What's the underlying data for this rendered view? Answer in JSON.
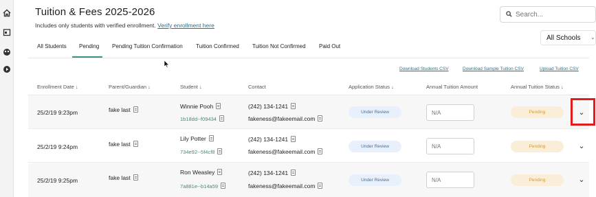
{
  "page": {
    "title": "Tuition & Fees 2025-2026",
    "subtitle": "Includes only students with verified enrollment.",
    "subtitle_link": "Verify enrollment here"
  },
  "search": {
    "placeholder": "Search..."
  },
  "school_filter": {
    "selected": "All Schools"
  },
  "tabs": [
    {
      "label": "All Students",
      "active": false
    },
    {
      "label": "Pending",
      "active": true
    },
    {
      "label": "Pending Tuition Confirmation",
      "active": false
    },
    {
      "label": "Tuition Confirmed",
      "active": false
    },
    {
      "label": "Tuition Not Confirmed",
      "active": false
    },
    {
      "label": "Paid Out",
      "active": false
    }
  ],
  "csv_links": {
    "download_students": "Download Students CSV",
    "download_sample": "Download Sample Tuition CSV",
    "upload": "Upload Tuition CSV"
  },
  "columns": {
    "enrollment_date": "Enrollment Date ↓",
    "parent": "Parent/Guardian ↓",
    "student": "Student ↓",
    "contact": "Contact",
    "application_status": "Application Status ↓",
    "annual_tuition_amount": "Annual Tuition Amount",
    "annual_tuition_status": "Annual Tuition Status ↓"
  },
  "rows": [
    {
      "date": "25/2/19 9:23pm",
      "parent": "fake last",
      "student": "Winnie Pooh",
      "student_id": "1b18dd--f09434",
      "phone": "(242) 134-1241",
      "email": "fakeness@fakeemail.com",
      "app_status": "Under Review",
      "tuition_placeholder": "N/A",
      "tuition_status": "Pending"
    },
    {
      "date": "25/2/19 9:24pm",
      "parent": "fake last",
      "student": "Lily Potter",
      "student_id": "734e92--5f4cf8",
      "phone": "(242) 134-1241",
      "email": "fakeness@fakeemail.com",
      "app_status": "Under Review",
      "tuition_placeholder": "N/A",
      "tuition_status": "Pending"
    },
    {
      "date": "25/2/19 9:25pm",
      "parent": "fake last",
      "student": "Ron Weasley",
      "student_id": "7a881e--b14a59",
      "phone": "(242) 134-1241",
      "email": "fakeness@fakeemail.com",
      "app_status": "Under Review",
      "tuition_placeholder": "N/A",
      "tuition_status": "Pending"
    }
  ],
  "icons": {
    "rail": [
      "home-icon",
      "calendar-icon",
      "community-icon",
      "play-icon"
    ]
  },
  "colors": {
    "accent": "#3d8f8a",
    "link": "#2b6f8a",
    "highlight": "#e31b1b",
    "pending_bg": "#fbeed9",
    "review_bg": "#e8f1fb"
  }
}
